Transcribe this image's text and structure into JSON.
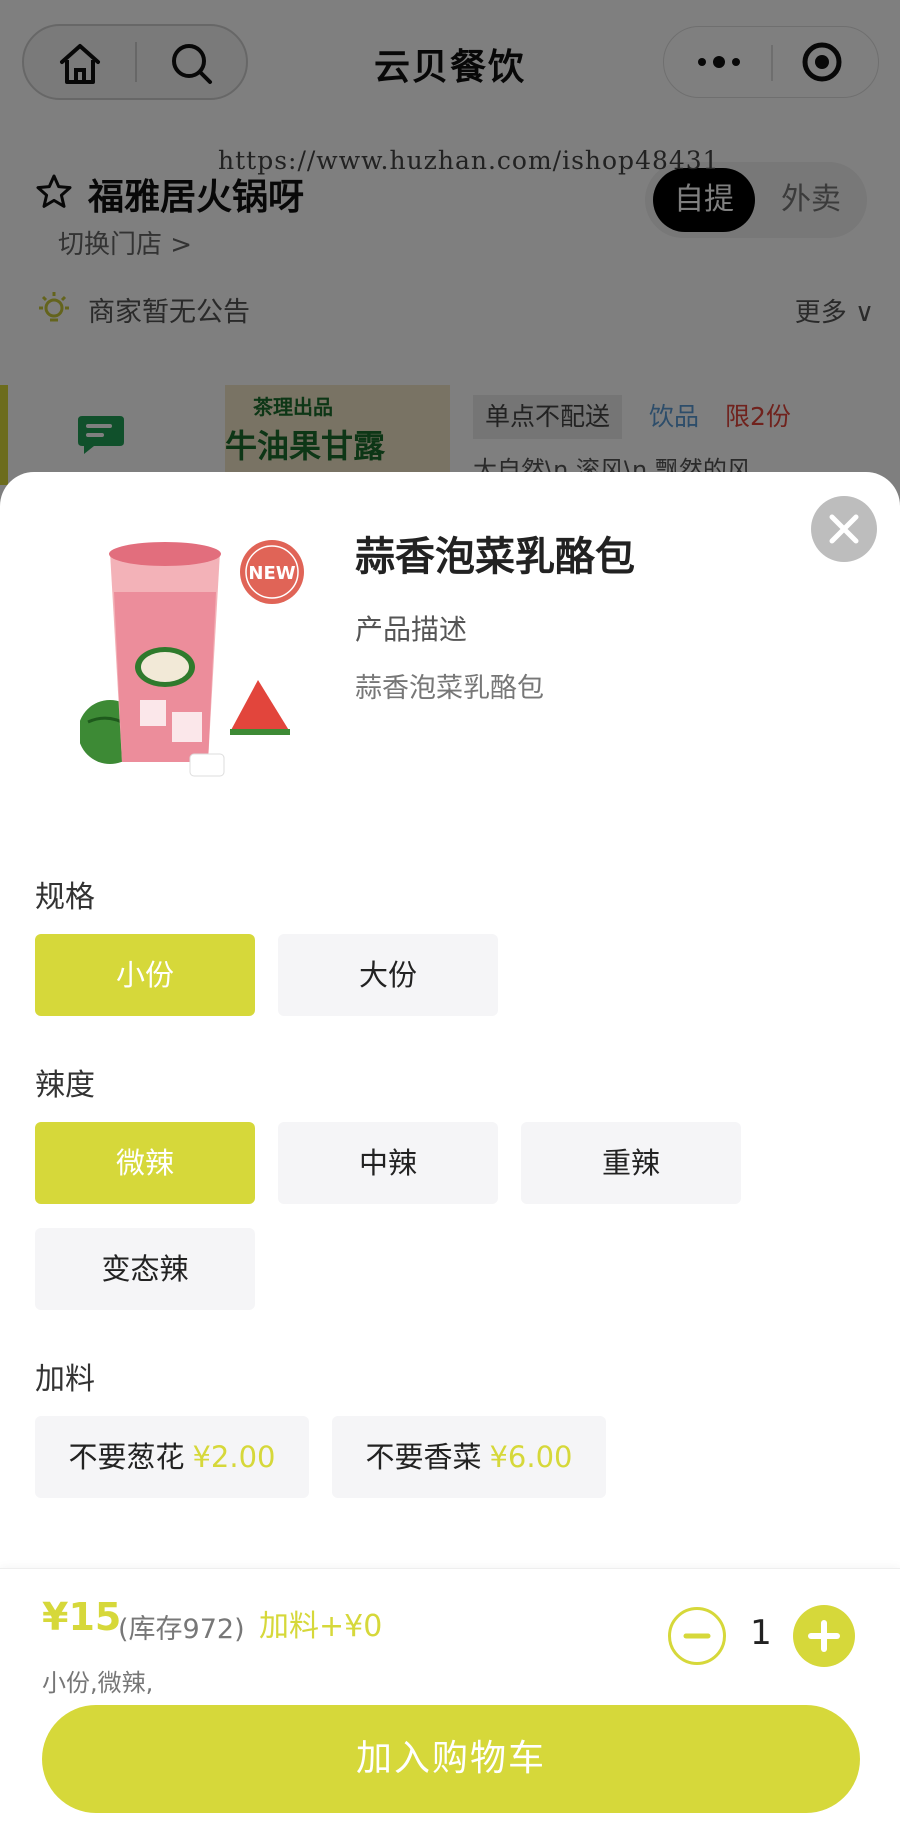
{
  "app": {
    "title": "云贝餐饮"
  },
  "watermark": "https://www.huzhan.com/ishop48431",
  "store": {
    "name": "福雅居火锅呀",
    "switch_label": "切换门店 >",
    "modes": [
      "自提",
      "外卖"
    ],
    "selected_mode": "自提",
    "notice": "商家暂无公告",
    "notice_more": "更多 ∨"
  },
  "background_product": {
    "thumb_text_top": "茶理出品",
    "thumb_text_main": "牛油果甘露",
    "tags": {
      "no_delivery": "单点不配送",
      "category": "饮品",
      "limit": "限2份"
    },
    "desc": "大自然\\n 滚风\\n 飘然的风"
  },
  "product": {
    "name": "蒜香泡菜乳酪包",
    "desc_label": "产品描述",
    "desc": "蒜香泡菜乳酪包",
    "image_badge": "NEW"
  },
  "spec": {
    "title": "规格",
    "options": [
      "小份",
      "大份"
    ],
    "selected": "小份"
  },
  "spice": {
    "title": "辣度",
    "options": [
      "微辣",
      "中辣",
      "重辣",
      "变态辣"
    ],
    "selected": "微辣"
  },
  "addons": {
    "title": "加料",
    "options": [
      {
        "label": "不要葱花",
        "price": "¥2.00"
      },
      {
        "label": "不要香菜",
        "price": "¥6.00"
      }
    ]
  },
  "footer": {
    "price": "¥15",
    "stock": "(库存972)",
    "addon_total": "加料+¥0",
    "summary": "小份,微辣,",
    "quantity": "1",
    "add_to_cart": "加入购物车"
  },
  "colors": {
    "accent": "#d6d83a",
    "overlay": "rgba(0,0,0,0.5)"
  },
  "icons": [
    "home-icon",
    "search-icon",
    "more-icon",
    "scan-icon",
    "star-icon",
    "bulb-icon",
    "chat-icon",
    "close-icon",
    "minus-icon",
    "plus-icon"
  ]
}
